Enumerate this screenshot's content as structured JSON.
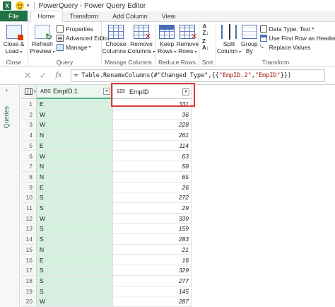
{
  "titlebar": {
    "app_logo": "X",
    "title": "PowerQuery - Power Query Editor",
    "quick_access_caret": "▾"
  },
  "tabs": [
    {
      "label": "File"
    },
    {
      "label": "Home"
    },
    {
      "label": "Transform"
    },
    {
      "label": "Add Column"
    },
    {
      "label": "View"
    }
  ],
  "ribbon": {
    "close": {
      "close_load_line1": "Close &",
      "close_load_line2": "Load",
      "group_label": "Close"
    },
    "query": {
      "refresh_line1": "Refresh",
      "refresh_line2": "Preview",
      "properties": "Properties",
      "advanced_editor": "Advanced Editor",
      "manage": "Manage",
      "group_label": "Query"
    },
    "manage_columns": {
      "choose_line1": "Choose",
      "choose_line2": "Columns",
      "remove_line1": "Remove",
      "remove_line2": "Columns",
      "group_label": "Manage Columns"
    },
    "reduce_rows": {
      "keep_line1": "Keep",
      "keep_line2": "Rows",
      "remove_line1": "Remove",
      "remove_line2": "Rows",
      "group_label": "Reduce Rows"
    },
    "sort": {
      "group_label": "Sort"
    },
    "transform": {
      "split_line1": "Split",
      "split_line2": "Column",
      "group_line1": "Group",
      "group_line2": "By",
      "data_type": "Data Type: Text",
      "first_row": "Use First Row as Headers",
      "replace_values": "Replace Values",
      "group_label": "Transform"
    }
  },
  "formula_bar": {
    "cancel_glyph": "✕",
    "confirm_glyph": "✓",
    "fx_glyph": "fx",
    "formula_prefix": "= Table.RenameColumns(#\"Changed Type\",{{",
    "formula_str1": "\"EmpID.2\"",
    "formula_mid": ", ",
    "formula_str2": "\"EmpID\"",
    "formula_suffix": "}})"
  },
  "queries_pane": {
    "label": "Queries",
    "chevron": "›"
  },
  "grid": {
    "col1": {
      "type": "ABC",
      "name": "EmpID.1"
    },
    "col2": {
      "type": "123",
      "name": "EmpID"
    },
    "rows": [
      {
        "n": "1",
        "a": "E",
        "b": "331"
      },
      {
        "n": "2",
        "a": "W",
        "b": "36"
      },
      {
        "n": "3",
        "a": "W",
        "b": "228"
      },
      {
        "n": "4",
        "a": "N",
        "b": "261"
      },
      {
        "n": "5",
        "a": "E",
        "b": "114"
      },
      {
        "n": "6",
        "a": "W",
        "b": "63"
      },
      {
        "n": "7",
        "a": "N",
        "b": "58"
      },
      {
        "n": "8",
        "a": "N",
        "b": "65"
      },
      {
        "n": "9",
        "a": "E",
        "b": "26"
      },
      {
        "n": "10",
        "a": "S",
        "b": "272"
      },
      {
        "n": "11",
        "a": "S",
        "b": "29"
      },
      {
        "n": "12",
        "a": "W",
        "b": "339"
      },
      {
        "n": "13",
        "a": "S",
        "b": "159"
      },
      {
        "n": "14",
        "a": "S",
        "b": "283"
      },
      {
        "n": "15",
        "a": "N",
        "b": "21"
      },
      {
        "n": "16",
        "a": "E",
        "b": "16"
      },
      {
        "n": "17",
        "a": "S",
        "b": "329"
      },
      {
        "n": "18",
        "a": "S",
        "b": "277"
      },
      {
        "n": "19",
        "a": "S",
        "b": "145"
      },
      {
        "n": "20",
        "a": "W",
        "b": "287"
      }
    ]
  },
  "colors": {
    "excel_green": "#217346",
    "column_selected": "#d6f0df",
    "highlight_red": "#e03a3a"
  }
}
